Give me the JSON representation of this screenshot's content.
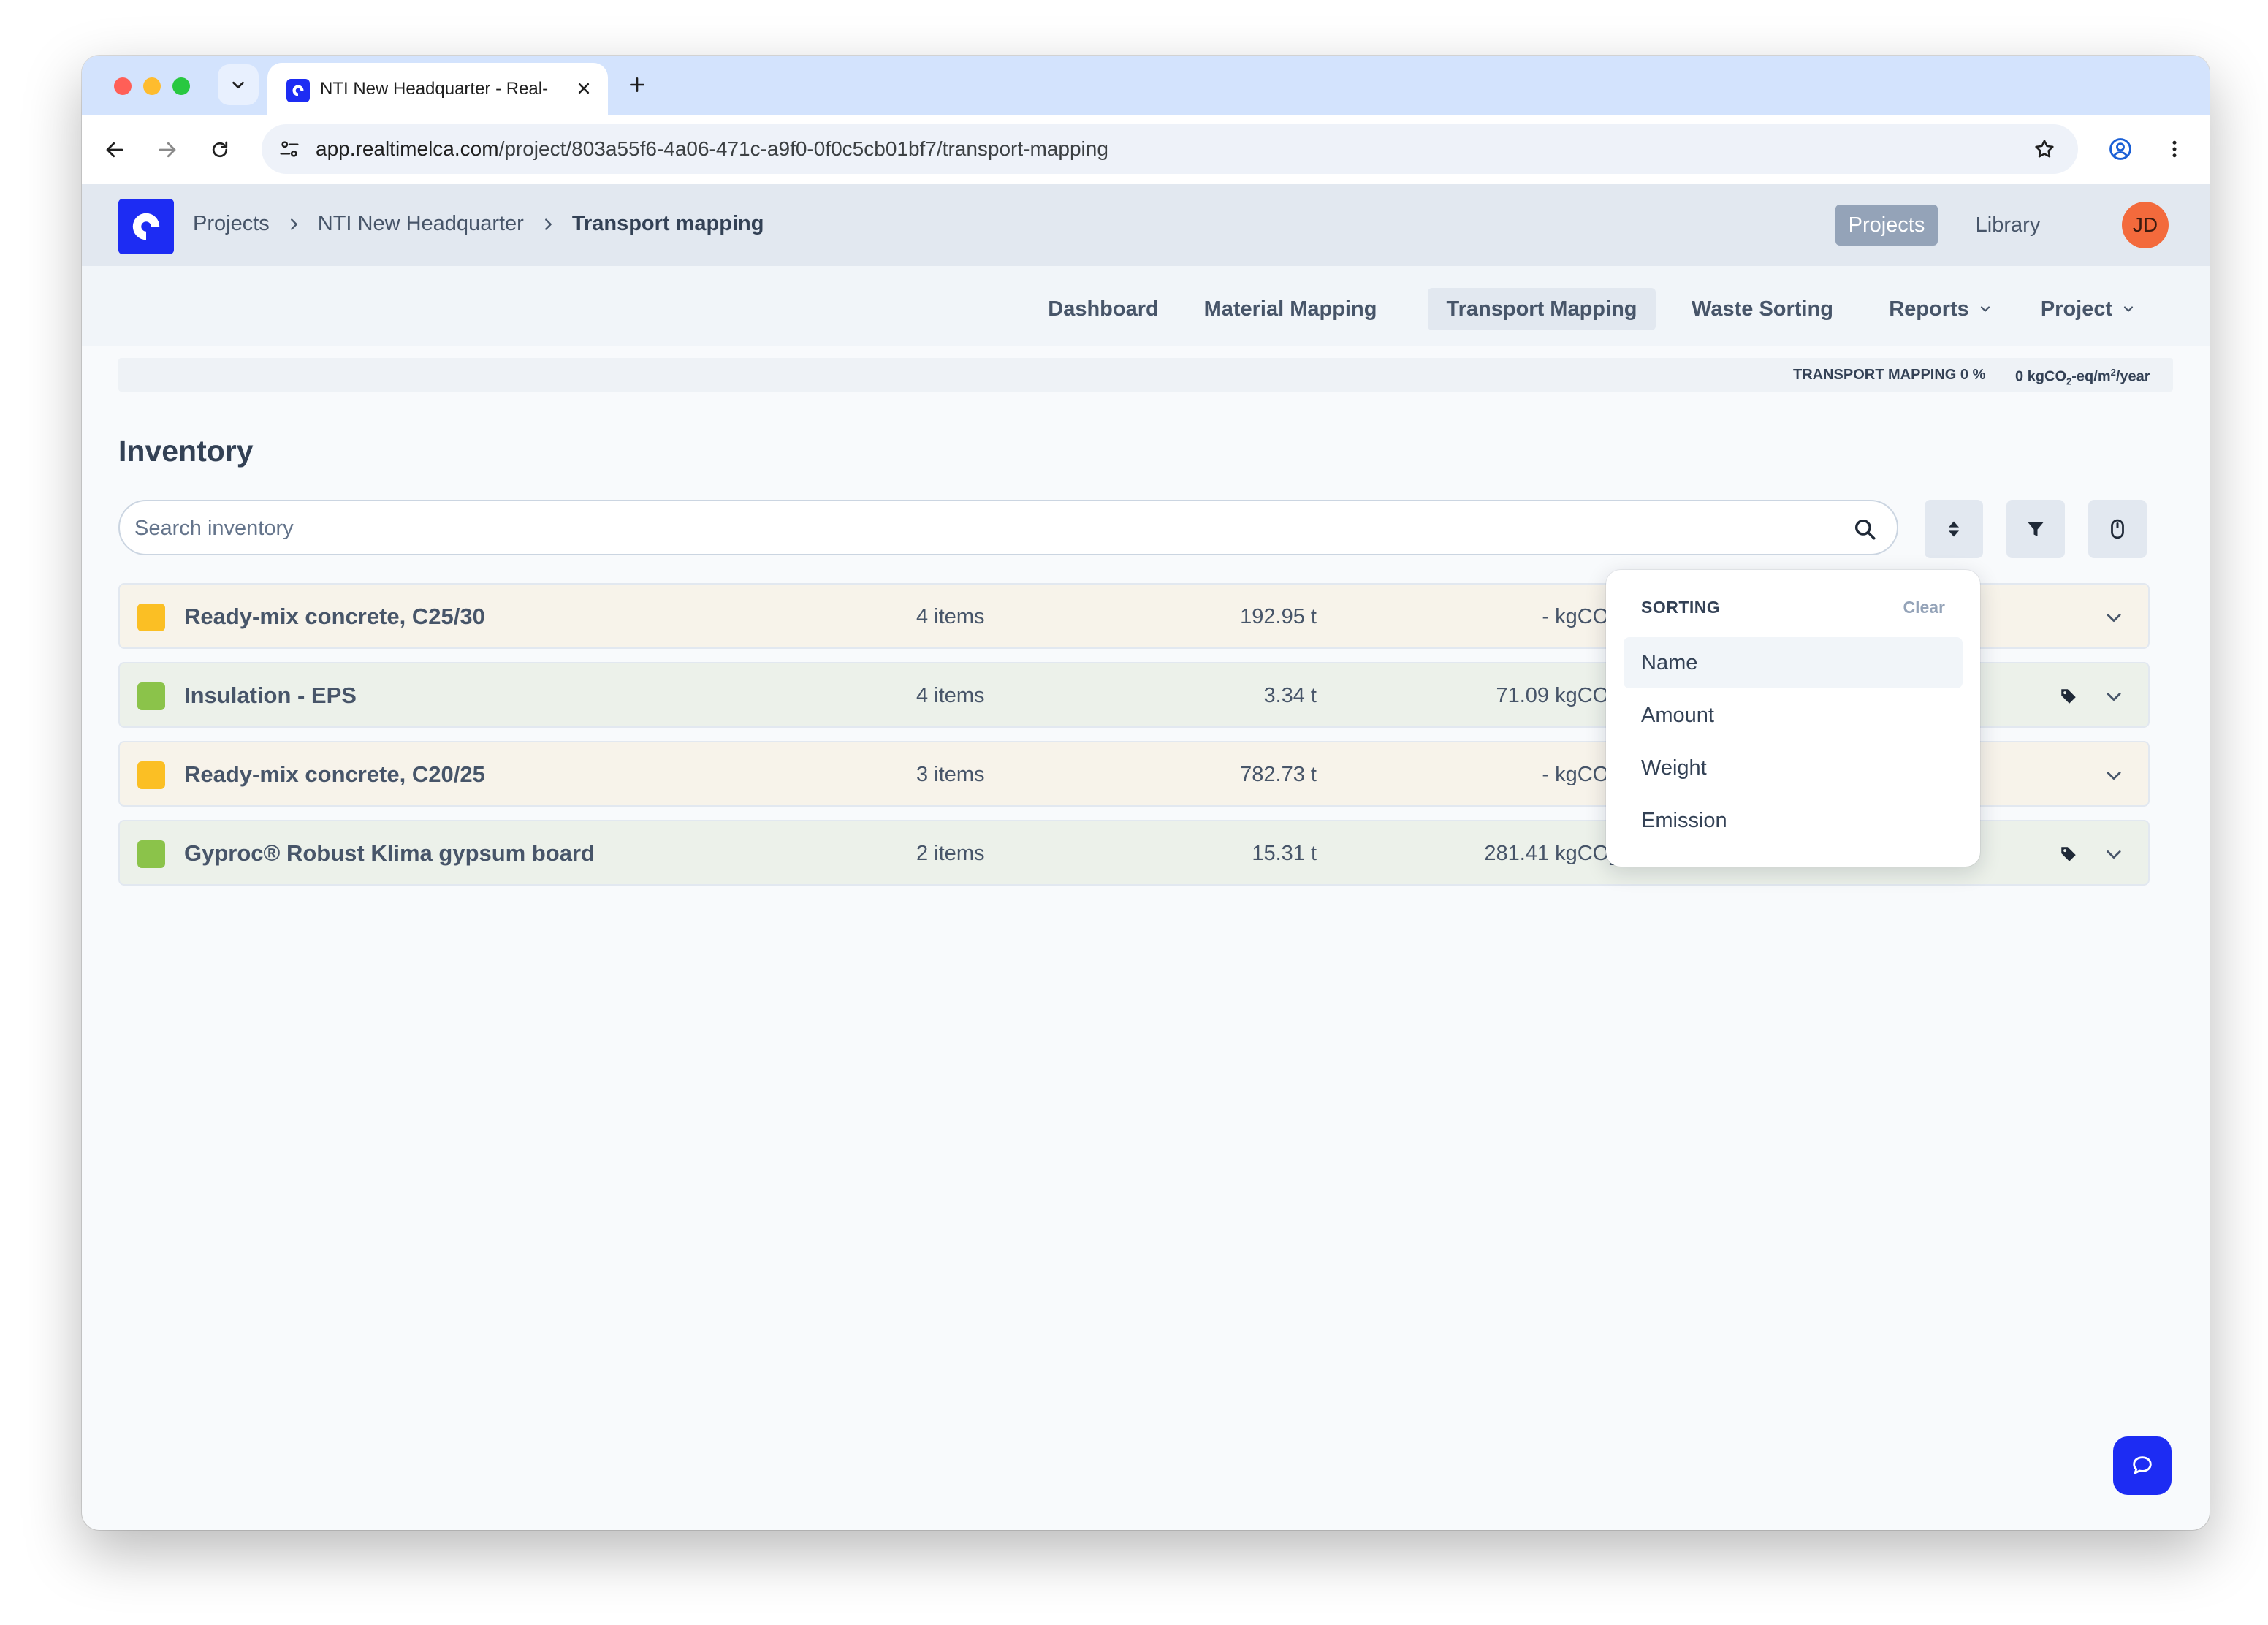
{
  "browser": {
    "tab_title": "NTI New Headquarter - Real-",
    "url_host": "app.realtimelca.com",
    "url_path": "/project/803a55f6-4a06-471c-a9f0-0f0c5cb01bf7/transport-mapping"
  },
  "header": {
    "breadcrumb": [
      "Projects",
      "NTI New Headquarter",
      "Transport mapping"
    ],
    "projects_label": "Projects",
    "library_label": "Library",
    "avatar_initials": "JD"
  },
  "subnav": {
    "items": [
      "Dashboard",
      "Material Mapping",
      "Transport Mapping",
      "Waste Sorting",
      "Reports",
      "Project"
    ],
    "active": "Transport Mapping"
  },
  "progress": {
    "label": "TRANSPORT MAPPING 0 %",
    "value_number": "0",
    "value_unit_a": "kgCO",
    "value_unit_sub": "2",
    "value_unit_b": "-eq/m",
    "value_unit_sup": "2",
    "value_unit_c": "/year"
  },
  "inventory": {
    "title": "Inventory",
    "search_placeholder": "Search inventory",
    "rows": [
      {
        "name": "Ready-mix concrete, C25/30",
        "count": "4 items",
        "weight": "192.95 t",
        "emission": "- kgCO",
        "status": "warning",
        "color": "#fbbf24"
      },
      {
        "name": "Insulation - EPS",
        "count": "4 items",
        "weight": "3.34 t",
        "emission": "71.09 kgCO",
        "status": "ok",
        "color": "#8bc34a"
      },
      {
        "name": "Ready-mix concrete, C20/25",
        "count": "3 items",
        "weight": "782.73 t",
        "emission": "- kgCO",
        "status": "warning",
        "color": "#fbbf24"
      },
      {
        "name": "Gyproc® Robust Klima gypsum board",
        "count": "2 items",
        "weight": "15.31 t",
        "emission": "281.41 kgCO",
        "status": "ok",
        "color": "#8bc34a"
      }
    ],
    "emission_sub": "2"
  },
  "sorting": {
    "title": "SORTING",
    "clear_label": "Clear",
    "options": [
      "Name",
      "Amount",
      "Weight",
      "Emission"
    ],
    "selected": "Name"
  },
  "colors": {
    "brand": "#1d2cf3",
    "warning": "#fbbf24",
    "ok": "#8bc34a",
    "avatar": "#f36a3c"
  }
}
